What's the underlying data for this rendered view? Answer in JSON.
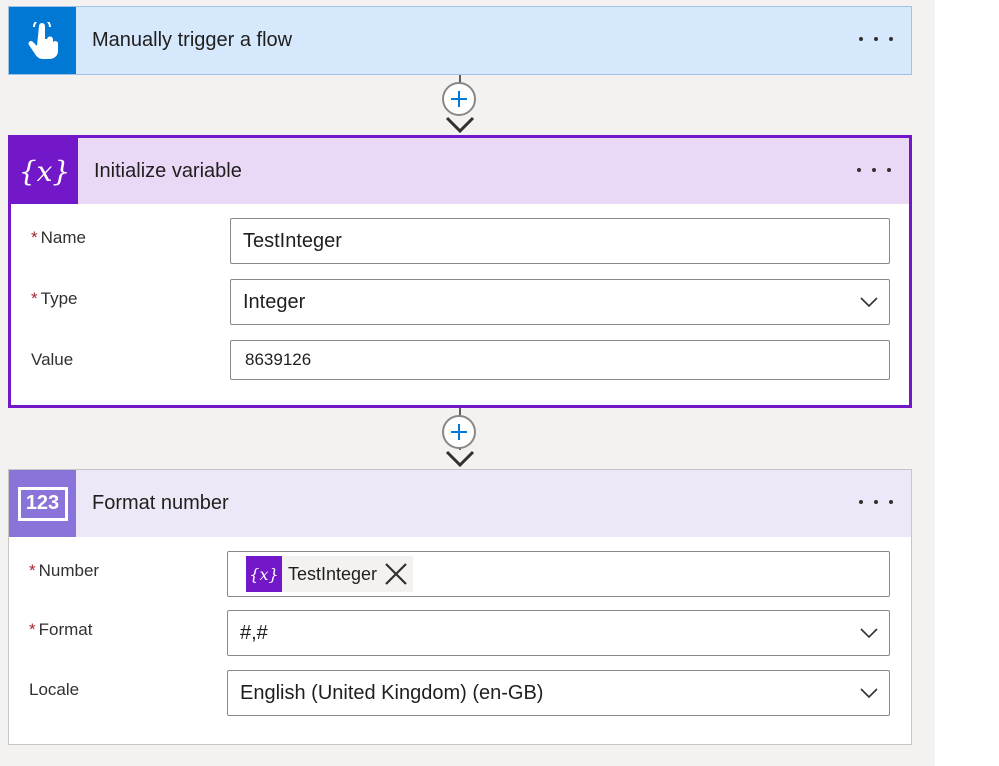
{
  "trigger": {
    "title": "Manually trigger a flow",
    "icon": "touch-hand-icon"
  },
  "init_variable": {
    "title": "Initialize variable",
    "icon": "variable-x-icon",
    "icon_text": "{x}",
    "fields": {
      "name": {
        "label": "Name",
        "required": "*",
        "value": "TestInteger"
      },
      "type": {
        "label": "Type",
        "required": "*",
        "value": "Integer"
      },
      "value": {
        "label": "Value",
        "value": "8639126"
      }
    }
  },
  "format_number": {
    "title": "Format number",
    "icon": "number-123-icon",
    "icon_text": "123",
    "fields": {
      "number": {
        "label": "Number",
        "required": "*",
        "token_label": "TestInteger",
        "token_icon_text": "{x}"
      },
      "format": {
        "label": "Format",
        "required": "*",
        "value": "#,#"
      },
      "locale": {
        "label": "Locale",
        "value": "English (United Kingdom) (en-GB)"
      }
    }
  },
  "colors": {
    "trigger_accent": "#0078d4",
    "variable_accent": "#7318c8",
    "number_accent": "#8a73d9",
    "required": "#a4262c"
  }
}
